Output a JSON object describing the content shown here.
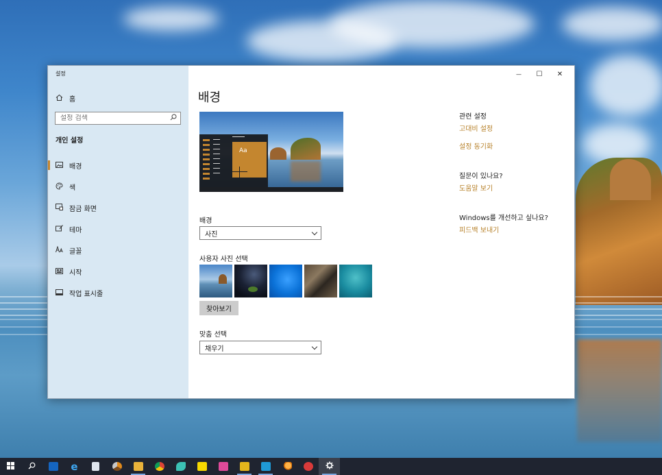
{
  "window": {
    "app_title": "설정",
    "controls": {
      "minimize": "—",
      "maximize": "☐",
      "close": "✕"
    }
  },
  "sidebar": {
    "home_label": "홈",
    "search_placeholder": "설정 검색",
    "section_title": "개인 설정",
    "items": [
      {
        "label": "배경",
        "icon": "image-icon",
        "active": true
      },
      {
        "label": "색",
        "icon": "palette-icon",
        "active": false
      },
      {
        "label": "잠금 화면",
        "icon": "lock-screen-icon",
        "active": false
      },
      {
        "label": "테마",
        "icon": "theme-icon",
        "active": false
      },
      {
        "label": "글꼴",
        "icon": "font-icon",
        "active": false
      },
      {
        "label": "시작",
        "icon": "start-icon",
        "active": false
      },
      {
        "label": "작업 표시줄",
        "icon": "taskbar-icon",
        "active": false
      }
    ]
  },
  "main": {
    "title": "배경",
    "preview": {
      "sample_text": "Aa"
    },
    "background": {
      "label": "배경",
      "selected": "사진"
    },
    "photos": {
      "label": "사용자 사진 선택",
      "browse_label": "찾아보기"
    },
    "fit": {
      "label": "맞춤 선택",
      "selected": "채우기"
    }
  },
  "related": {
    "title": "관련 설정",
    "links": [
      "고대비 설정",
      "설정 동기화"
    ],
    "question_title": "질문이 있나요?",
    "help_link": "도움말 보기",
    "improve_title": "Windows를 개선하고 싶나요?",
    "feedback_link": "피드백 보내기"
  },
  "colors": {
    "accent": "#c4862f",
    "link": "#b7822b",
    "sidebar_bg": "#d6e6f2",
    "taskbar_bg": "#1f2430"
  },
  "taskbar": {
    "items": [
      "start-icon",
      "search-icon",
      "outlook-icon",
      "edge-icon",
      "notepad-icon",
      "chrome-canary-icon",
      "file-explorer-icon",
      "chrome-icon",
      "bird-app-icon",
      "kakaotalk-icon",
      "pink-app-icon",
      "sticky-app-icon",
      "blue-app-icon",
      "search-app-icon",
      "red-app-icon",
      "settings-icon"
    ]
  }
}
